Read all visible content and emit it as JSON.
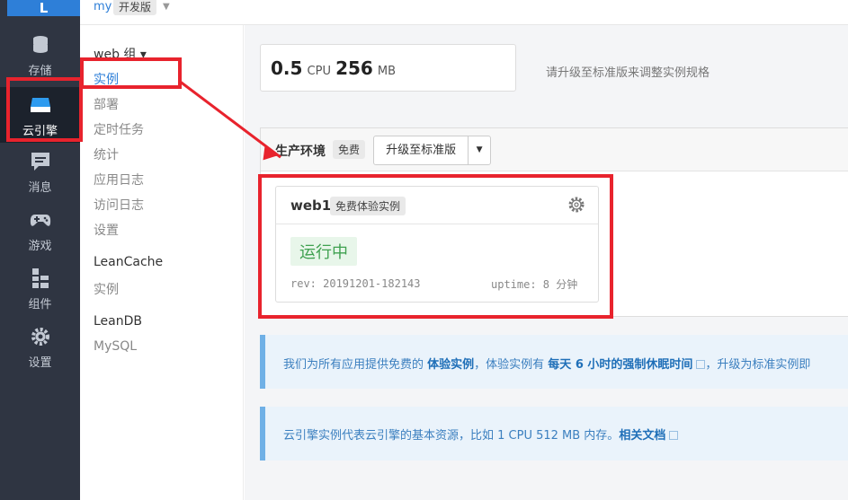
{
  "rail": {
    "logo": "L",
    "items": [
      {
        "label": "存储",
        "icon": "database-icon"
      },
      {
        "label": "云引擎",
        "icon": "cloud-engine-icon"
      },
      {
        "label": "消息",
        "icon": "message-icon"
      },
      {
        "label": "游戏",
        "icon": "gamepad-icon"
      },
      {
        "label": "组件",
        "icon": "component-icon"
      },
      {
        "label": "设置",
        "icon": "gear-icon"
      }
    ],
    "active": "云引擎"
  },
  "topbar": {
    "app_name": "my",
    "plan": "开发版"
  },
  "subnav": {
    "group_web": "web 组 ▾",
    "web_items": [
      "实例",
      "部署",
      "定时任务",
      "统计",
      "应用日志",
      "访问日志",
      "设置"
    ],
    "group_leancache": "LeanCache",
    "leancache_items": [
      "实例"
    ],
    "group_leandb": "LeanDB",
    "leandb_items": [
      "MySQL"
    ]
  },
  "spec": {
    "cpu_value": "0.5",
    "cpu_unit": "CPU",
    "mem_value": "256",
    "mem_unit": "MB",
    "hint": "请升级至标准版来调整实例规格"
  },
  "env": {
    "title": "生产环境",
    "badge": "免费",
    "upgrade_label": "升级至标准版"
  },
  "instance": {
    "name": "web1",
    "tag": "免费体验实例",
    "status": "运行中",
    "rev": "rev: 20191201-182143",
    "uptime": "uptime: 8 分钟"
  },
  "notice1": {
    "prefix": "我们为所有应用提供免费的 ",
    "b1": "体验实例",
    "mid": "，体验实例有 ",
    "b2": "每天 6 小时的强制休眠时间",
    "suffix": "，升级为标准实例即"
  },
  "notice2": {
    "text": "云引擎实例代表云引擎的基本资源，比如 1 CPU 512 MB 内存。",
    "link": "相关文档"
  },
  "colors": {
    "rail": "#2f3542",
    "accent": "#2e7fd8",
    "annotation": "#e8232d",
    "running": "#3fa150"
  }
}
